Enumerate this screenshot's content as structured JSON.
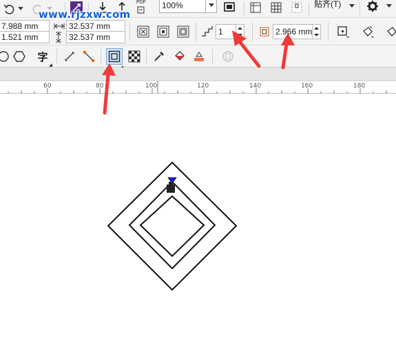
{
  "watermark": "www.rjzxw.com",
  "toolbar_top": {
    "zoom_value": "100%",
    "snap_label": "贴齐(T)",
    "pdf_label": "PDF"
  },
  "property_bar": {
    "x_value": "7.988 mm",
    "y_value": "1.521 mm",
    "width_value": "32.537 mm",
    "height_value": "32.537 mm",
    "steps_value": "1",
    "offset_value": "2.966 mm"
  },
  "tool_row": {
    "text_tool_glyph": "字"
  },
  "ruler": {
    "ticks": [
      "60",
      "80",
      "100",
      "120",
      "140",
      "160",
      "180"
    ]
  },
  "colors": {
    "annotation_arrow": "#f03a3a",
    "watermark": "#1560d8",
    "selected_node": "#1a1aff"
  }
}
